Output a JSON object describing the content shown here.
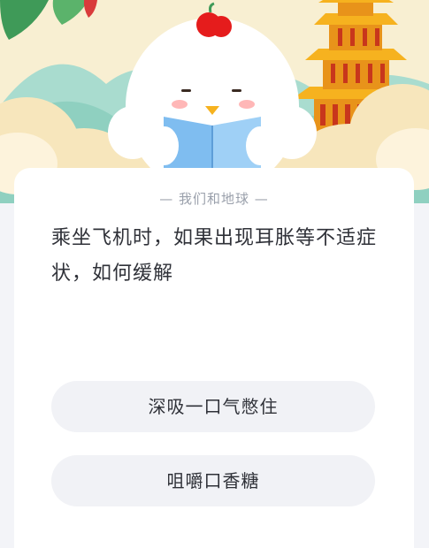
{
  "quiz": {
    "category": "— 我们和地球 —",
    "question": "乘坐飞机时，如果出现耳胀等不适症状，如何缓解",
    "options": [
      {
        "label": "深吸一口气憋住"
      },
      {
        "label": "咀嚼口香糖"
      }
    ]
  },
  "colors": {
    "sky": "#f8efd2",
    "mountain": "#8fd0c0",
    "cloud": "#f7e3b2",
    "chicken": "#ffffff",
    "comb": "#e51c1c",
    "book": "#7fbdf0",
    "tower": "#f0a31c",
    "card_bg": "#ffffff",
    "option_bg": "#f1f2f6",
    "text_primary": "#2f3138",
    "text_secondary": "#9aa0ab"
  },
  "icons": [
    "mascot-chicken-icon",
    "yellow-crane-tower-icon",
    "open-book-icon"
  ]
}
